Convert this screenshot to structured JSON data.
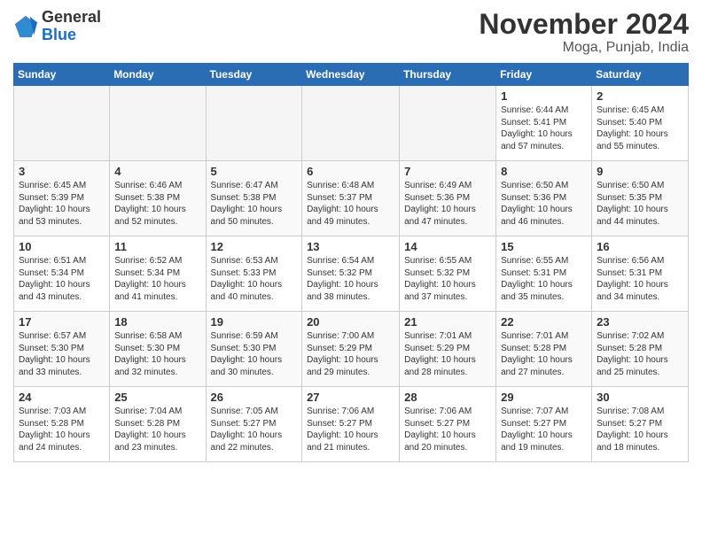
{
  "header": {
    "logo_general": "General",
    "logo_blue": "Blue",
    "month_year": "November 2024",
    "location": "Moga, Punjab, India"
  },
  "days_of_week": [
    "Sunday",
    "Monday",
    "Tuesday",
    "Wednesday",
    "Thursday",
    "Friday",
    "Saturday"
  ],
  "weeks": [
    [
      {
        "day": "",
        "info": ""
      },
      {
        "day": "",
        "info": ""
      },
      {
        "day": "",
        "info": ""
      },
      {
        "day": "",
        "info": ""
      },
      {
        "day": "",
        "info": ""
      },
      {
        "day": "1",
        "info": "Sunrise: 6:44 AM\nSunset: 5:41 PM\nDaylight: 10 hours and 57 minutes."
      },
      {
        "day": "2",
        "info": "Sunrise: 6:45 AM\nSunset: 5:40 PM\nDaylight: 10 hours and 55 minutes."
      }
    ],
    [
      {
        "day": "3",
        "info": "Sunrise: 6:45 AM\nSunset: 5:39 PM\nDaylight: 10 hours and 53 minutes."
      },
      {
        "day": "4",
        "info": "Sunrise: 6:46 AM\nSunset: 5:38 PM\nDaylight: 10 hours and 52 minutes."
      },
      {
        "day": "5",
        "info": "Sunrise: 6:47 AM\nSunset: 5:38 PM\nDaylight: 10 hours and 50 minutes."
      },
      {
        "day": "6",
        "info": "Sunrise: 6:48 AM\nSunset: 5:37 PM\nDaylight: 10 hours and 49 minutes."
      },
      {
        "day": "7",
        "info": "Sunrise: 6:49 AM\nSunset: 5:36 PM\nDaylight: 10 hours and 47 minutes."
      },
      {
        "day": "8",
        "info": "Sunrise: 6:50 AM\nSunset: 5:36 PM\nDaylight: 10 hours and 46 minutes."
      },
      {
        "day": "9",
        "info": "Sunrise: 6:50 AM\nSunset: 5:35 PM\nDaylight: 10 hours and 44 minutes."
      }
    ],
    [
      {
        "day": "10",
        "info": "Sunrise: 6:51 AM\nSunset: 5:34 PM\nDaylight: 10 hours and 43 minutes."
      },
      {
        "day": "11",
        "info": "Sunrise: 6:52 AM\nSunset: 5:34 PM\nDaylight: 10 hours and 41 minutes."
      },
      {
        "day": "12",
        "info": "Sunrise: 6:53 AM\nSunset: 5:33 PM\nDaylight: 10 hours and 40 minutes."
      },
      {
        "day": "13",
        "info": "Sunrise: 6:54 AM\nSunset: 5:32 PM\nDaylight: 10 hours and 38 minutes."
      },
      {
        "day": "14",
        "info": "Sunrise: 6:55 AM\nSunset: 5:32 PM\nDaylight: 10 hours and 37 minutes."
      },
      {
        "day": "15",
        "info": "Sunrise: 6:55 AM\nSunset: 5:31 PM\nDaylight: 10 hours and 35 minutes."
      },
      {
        "day": "16",
        "info": "Sunrise: 6:56 AM\nSunset: 5:31 PM\nDaylight: 10 hours and 34 minutes."
      }
    ],
    [
      {
        "day": "17",
        "info": "Sunrise: 6:57 AM\nSunset: 5:30 PM\nDaylight: 10 hours and 33 minutes."
      },
      {
        "day": "18",
        "info": "Sunrise: 6:58 AM\nSunset: 5:30 PM\nDaylight: 10 hours and 32 minutes."
      },
      {
        "day": "19",
        "info": "Sunrise: 6:59 AM\nSunset: 5:30 PM\nDaylight: 10 hours and 30 minutes."
      },
      {
        "day": "20",
        "info": "Sunrise: 7:00 AM\nSunset: 5:29 PM\nDaylight: 10 hours and 29 minutes."
      },
      {
        "day": "21",
        "info": "Sunrise: 7:01 AM\nSunset: 5:29 PM\nDaylight: 10 hours and 28 minutes."
      },
      {
        "day": "22",
        "info": "Sunrise: 7:01 AM\nSunset: 5:28 PM\nDaylight: 10 hours and 27 minutes."
      },
      {
        "day": "23",
        "info": "Sunrise: 7:02 AM\nSunset: 5:28 PM\nDaylight: 10 hours and 25 minutes."
      }
    ],
    [
      {
        "day": "24",
        "info": "Sunrise: 7:03 AM\nSunset: 5:28 PM\nDaylight: 10 hours and 24 minutes."
      },
      {
        "day": "25",
        "info": "Sunrise: 7:04 AM\nSunset: 5:28 PM\nDaylight: 10 hours and 23 minutes."
      },
      {
        "day": "26",
        "info": "Sunrise: 7:05 AM\nSunset: 5:27 PM\nDaylight: 10 hours and 22 minutes."
      },
      {
        "day": "27",
        "info": "Sunrise: 7:06 AM\nSunset: 5:27 PM\nDaylight: 10 hours and 21 minutes."
      },
      {
        "day": "28",
        "info": "Sunrise: 7:06 AM\nSunset: 5:27 PM\nDaylight: 10 hours and 20 minutes."
      },
      {
        "day": "29",
        "info": "Sunrise: 7:07 AM\nSunset: 5:27 PM\nDaylight: 10 hours and 19 minutes."
      },
      {
        "day": "30",
        "info": "Sunrise: 7:08 AM\nSunset: 5:27 PM\nDaylight: 10 hours and 18 minutes."
      }
    ]
  ]
}
